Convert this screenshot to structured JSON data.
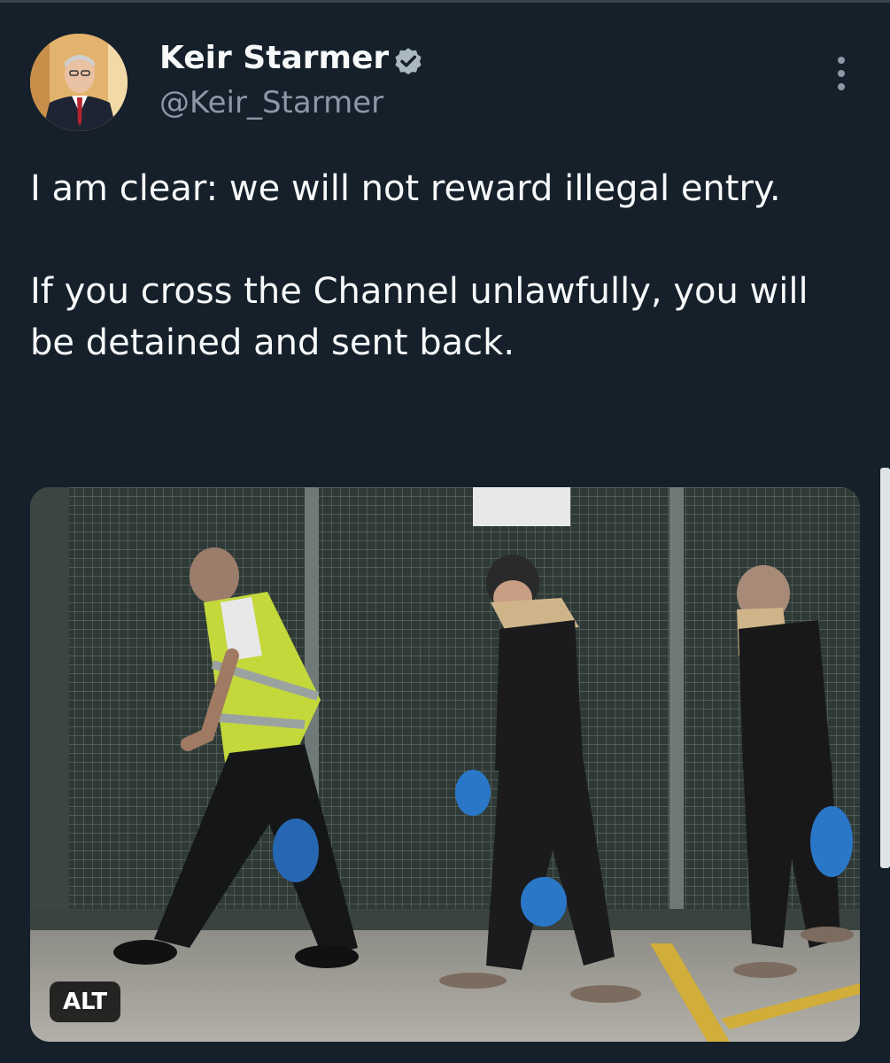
{
  "author": {
    "name": "Keir Starmer",
    "handle": "@Keir_Starmer",
    "verified": true
  },
  "icons": {
    "verified": "verified-badge-icon",
    "more": "more-options-icon"
  },
  "tweet": {
    "paragraphs": [
      "I am clear: we will not reward illegal entry.",
      "If you cross the Channel unlawfully, you will be detained and sent back."
    ]
  },
  "media": {
    "alt_label": "ALT"
  },
  "colors": {
    "background": "#15202b",
    "primary_text": "#f7f9f9",
    "secondary_text": "#8b98a5",
    "verified_badge": "#aab8c2"
  }
}
